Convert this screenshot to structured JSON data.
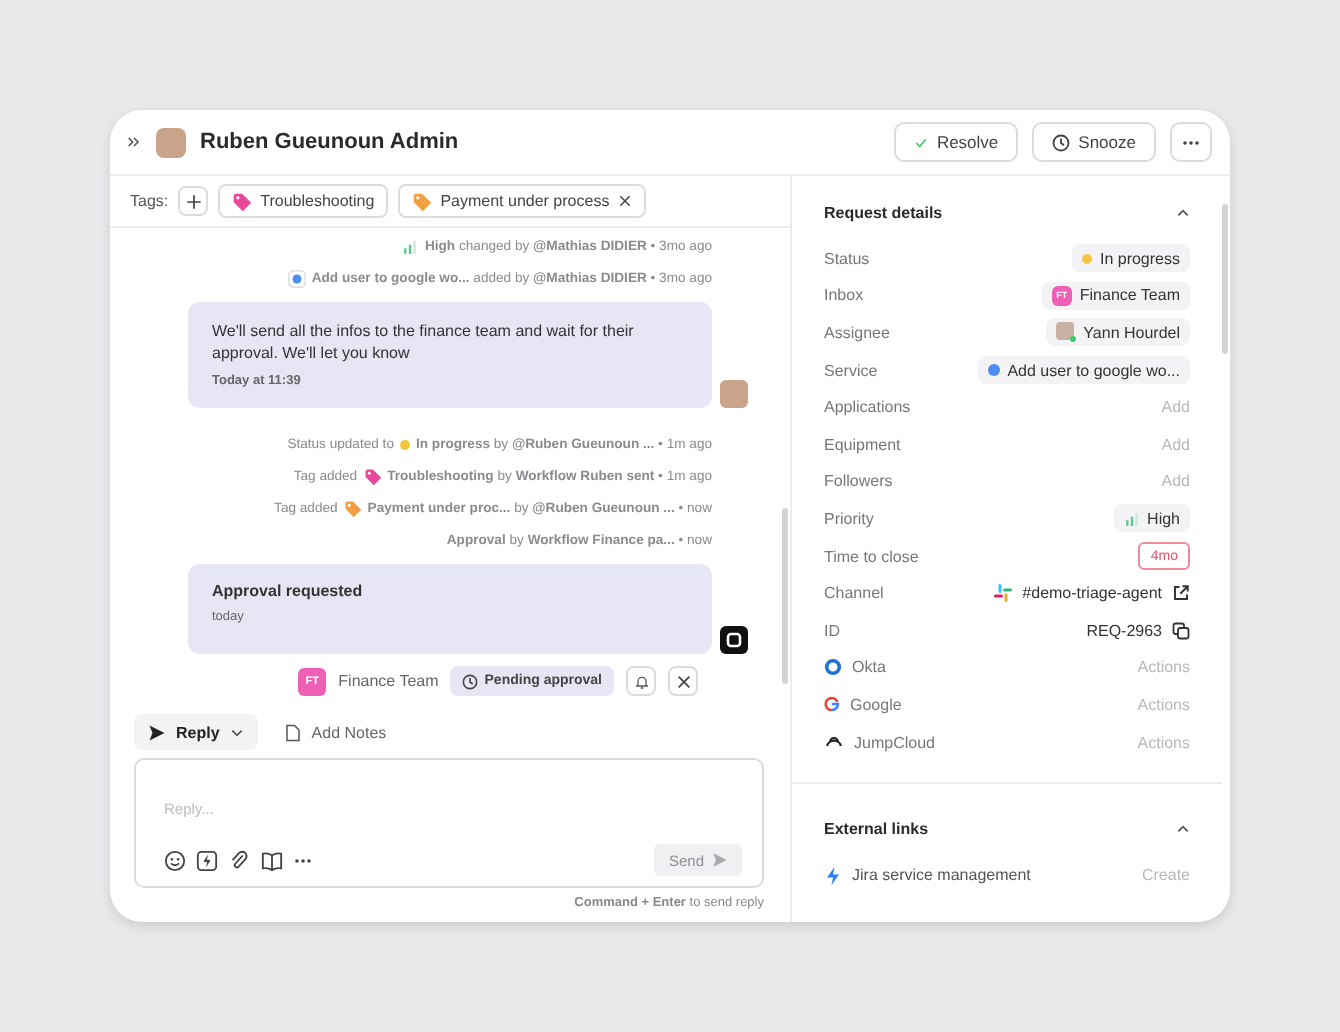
{
  "header": {
    "title": "Ruben Gueunoun Admin",
    "buttons": [
      {
        "kind": "resolve",
        "label": "Resolve"
      },
      {
        "kind": "snooze",
        "label": "Snooze"
      },
      {
        "kind": "more"
      }
    ]
  },
  "tags": {
    "label": "Tags:",
    "items": [
      {
        "label": "Troubleshooting",
        "color": "#e8489b",
        "removable": false
      },
      {
        "label": "Payment under process",
        "color": "#f0a040",
        "removable": true
      }
    ]
  },
  "feed": [
    {
      "kind": "priority",
      "text": "**High** changed by **@Mathias DIDIER** • 3mo ago"
    },
    {
      "kind": "service",
      "text": "**Add user to google wo...** added by **@Mathias DIDIER** • 3mo ago"
    },
    {
      "kind": "message",
      "text": "We'll send all the infos to the finance team and wait for their approval. We'll let you know",
      "time": "Today at 11:39"
    },
    {
      "kind": "status",
      "prefix": "Status updated to",
      "text": "**In progress** by **@Ruben Gueunoun ...** • 1m ago",
      "color": "#f5c542"
    },
    {
      "kind": "tag",
      "prefix": "Tag added",
      "color": "#e8489b",
      "text": "**Troubleshooting** by **Workflow Ruben sent** • 1m ago"
    },
    {
      "kind": "tag",
      "prefix": "Tag added",
      "color": "#f0a040",
      "text": "**Payment under proc...** by **@Ruben Gueunoun ...** • now"
    },
    {
      "kind": "plain",
      "text": "**Approval** by **Workflow Finance pa...** • now"
    },
    {
      "kind": "request",
      "title": "Approval requested",
      "time": "today"
    },
    {
      "kind": "approval",
      "badge": "FT",
      "team": "Finance Team",
      "status": "Pending approval"
    }
  ],
  "composer": {
    "tabs": [
      {
        "kind": "reply",
        "label": "Reply",
        "selected": true
      },
      {
        "kind": "notes",
        "label": "Add Notes",
        "selected": false
      }
    ],
    "placeholder": "Reply...",
    "send": {
      "label": "Send",
      "disabled": true
    },
    "hint": "**Command + Enter** to send reply"
  },
  "details": {
    "title": "Request details",
    "expanded": true,
    "rows": [
      {
        "label": "Status",
        "kind": "status",
        "value": "In progress",
        "color": "#f5c542"
      },
      {
        "label": "Inbox",
        "kind": "inbox",
        "badge": "FT",
        "value": "Finance Team"
      },
      {
        "label": "Assignee",
        "kind": "person",
        "value": "Yann Hourdel"
      },
      {
        "label": "Service",
        "kind": "service",
        "value": "Add user to google wo..."
      },
      {
        "label": "Applications",
        "kind": "add",
        "value": "Add"
      },
      {
        "label": "Equipment",
        "kind": "add",
        "value": "Add"
      },
      {
        "label": "Followers",
        "kind": "add",
        "value": "Add"
      },
      {
        "label": "Priority",
        "kind": "priority",
        "value": "High"
      },
      {
        "label": "Time to close",
        "kind": "deadline",
        "value": "4mo"
      },
      {
        "label": "Channel",
        "kind": "channel",
        "value": "#demo-triage-agent"
      },
      {
        "label": "ID",
        "kind": "id",
        "value": "REQ-2963"
      },
      {
        "label": "Okta",
        "kind": "okta",
        "value": "Actions"
      },
      {
        "label": "Google",
        "kind": "google",
        "value": "Actions"
      },
      {
        "label": "JumpCloud",
        "kind": "jumpcloud",
        "value": "Actions"
      }
    ]
  },
  "external": {
    "title": "External links",
    "expanded": true,
    "items": [
      {
        "label": "Jira service management",
        "action": "Create"
      }
    ]
  }
}
